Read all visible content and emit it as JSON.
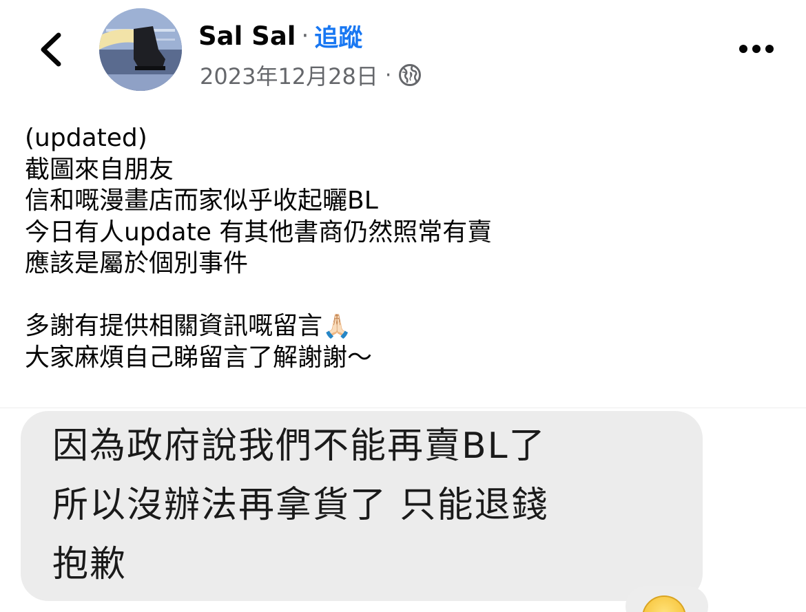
{
  "header": {
    "author": "Sal Sal",
    "separator": "·",
    "follow_label": "追蹤",
    "date": "2023年12月28日",
    "meta_separator": "·",
    "icons": {
      "back": "chevron-left-icon",
      "audience": "globe-icon",
      "more": "more-options-icon"
    }
  },
  "post": {
    "lines": [
      "(updated)",
      "截圖來自朋友",
      "信和嘅漫畫店而家似乎收起曬BL",
      "今日有人update 有其他書商仍然照常有賣",
      "應該是屬於個別事件",
      "",
      "多謝有提供相關資訊嘅留言",
      "大家麻煩自己睇留言了解謝謝～"
    ],
    "emoji_after_line_7": "🙏🏻"
  },
  "screenshot": {
    "message_lines": [
      "因為政府說我們不能再賣BL了",
      "所以沒辦法再拿貨了 只能退錢",
      "抱歉"
    ],
    "reaction_icon": "crying-face-icon"
  },
  "colors": {
    "accent": "#1877f2",
    "secondary_text": "#65676b",
    "bubble": "#ececec"
  }
}
